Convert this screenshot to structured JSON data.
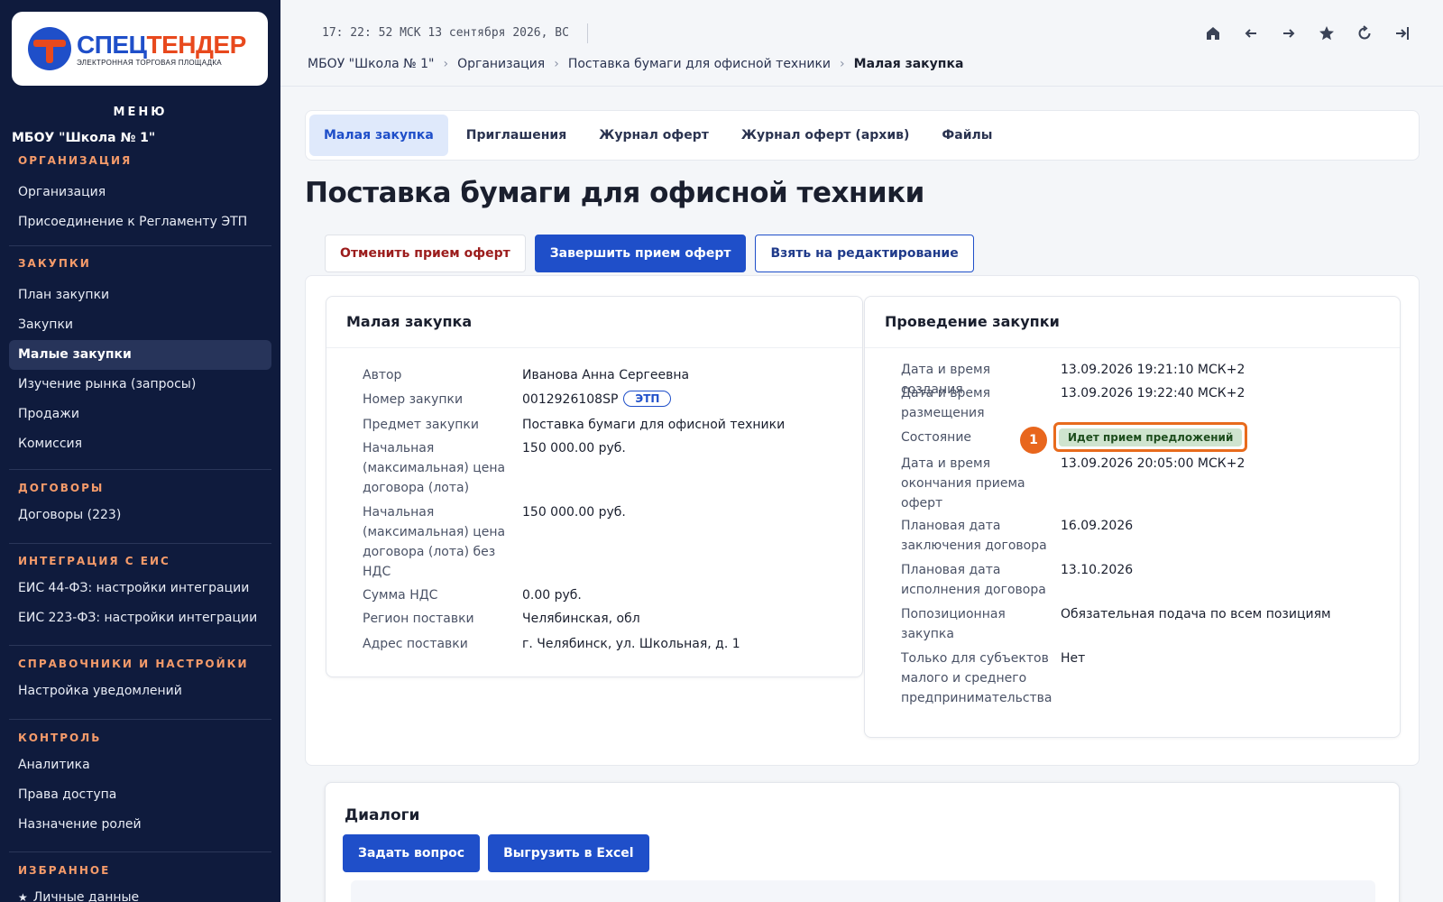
{
  "logo": {
    "title_part1": "СПЕЦ",
    "title_part2": "ТЕНДЕР",
    "subtitle": "ЭЛЕКТРОННАЯ ТОРГОВАЯ ПЛОЩАДКА"
  },
  "sidebar": {
    "menu_heading": "МЕНЮ",
    "org_name": "МБОУ \"Школа № 1\"",
    "sections": [
      {
        "title": "ОРГАНИЗАЦИЯ",
        "items": [
          "Организация",
          "Присоединение к Регламенту ЭТП"
        ]
      },
      {
        "title": "ЗАКУПКИ",
        "items": [
          "План закупки",
          "Закупки",
          "Малые закупки",
          "Изучение рынка (запросы)",
          "Продажи",
          "Комиссия"
        ]
      },
      {
        "title": "ДОГОВОРЫ",
        "items": [
          "Договоры (223)"
        ]
      },
      {
        "title": "ИНТЕГРАЦИЯ С ЕИС",
        "items": [
          "ЕИС 44-ФЗ: настройки интеграции",
          "ЕИС 223-ФЗ: настройки интеграции"
        ]
      },
      {
        "title": "СПРАВОЧНИКИ И НАСТРОЙКИ",
        "items": [
          "Настройка уведомлений"
        ]
      },
      {
        "title": "КОНТРОЛЬ",
        "items": [
          "Аналитика",
          "Права доступа",
          "Назначение ролей"
        ]
      },
      {
        "title": "ИЗБРАННОЕ",
        "items": [
          "Личные данные"
        ]
      }
    ]
  },
  "topbar": {
    "clock": "17: 22: 52 МСК  13 сентября 2026, ВС",
    "breadcrumb": [
      "МБОУ \"Школа № 1\"",
      "Организация",
      "Поставка бумаги для офисной техники",
      "Малая закупка"
    ],
    "breadcrumb_sep": "›",
    "icons": [
      "home-icon",
      "arrow-left-icon",
      "arrow-right-icon",
      "star-icon",
      "refresh-icon",
      "logout-icon"
    ]
  },
  "tabs": [
    "Малая закупка",
    "Приглашения",
    "Журнал оферт",
    "Журнал оферт (архив)",
    "Файлы"
  ],
  "page_title": "Поставка бумаги для офисной техники",
  "actions": {
    "cancel": "Отменить прием оферт",
    "finish": "Завершить прием оферт",
    "edit": "Взять на редактирование"
  },
  "purchase_panel": {
    "title": "Малая закупка",
    "rows": [
      {
        "k": "Автор",
        "v": "Иванова Анна Сергеевна"
      },
      {
        "k": "Номер закупки",
        "v": "0012926108SP",
        "badge": "ЭТП"
      },
      {
        "k": "Предмет закупки",
        "v": "Поставка бумаги для офисной техники"
      },
      {
        "k": "Начальная (максимальная) цена договора (лота)",
        "v": "150 000.00 руб."
      },
      {
        "k": "Начальная (максимальная) цена договора (лота) без НДС",
        "v": "150 000.00 руб."
      },
      {
        "k": "Сумма НДС",
        "v": "0.00 руб."
      },
      {
        "k": "Регион поставки",
        "v": "Челябинская, обл"
      },
      {
        "k": "Адрес поставки",
        "v": "г. Челябинск, ул. Школьная, д. 1"
      }
    ]
  },
  "conduct_panel": {
    "title": "Проведение закупки",
    "rows": [
      {
        "k": "Дата и время создания",
        "v": "13.09.2026 19:21:10 МСК+2"
      },
      {
        "k": "Дата и время размещения",
        "v": "13.09.2026 19:22:40 МСК+2"
      },
      {
        "k": "Состояние",
        "v": "Идет прием предложений"
      },
      {
        "k": "Дата и время окончания приема оферт",
        "v": "13.09.2026 20:05:00 МСК+2"
      },
      {
        "k": "Плановая дата заключения договора",
        "v": "16.09.2026"
      },
      {
        "k": "Плановая дата исполнения договора",
        "v": "13.10.2026"
      },
      {
        "k": "Попозиционная закупка",
        "v": "Обязательная подача по всем позициям"
      },
      {
        "k": "Только для субъектов малого и среднего предпринимательства",
        "v": "Нет"
      }
    ],
    "callout_number": "1"
  },
  "dialogs": {
    "title": "Диалоги",
    "ask": "Задать вопрос",
    "export": "Выгрузить в Excel"
  }
}
